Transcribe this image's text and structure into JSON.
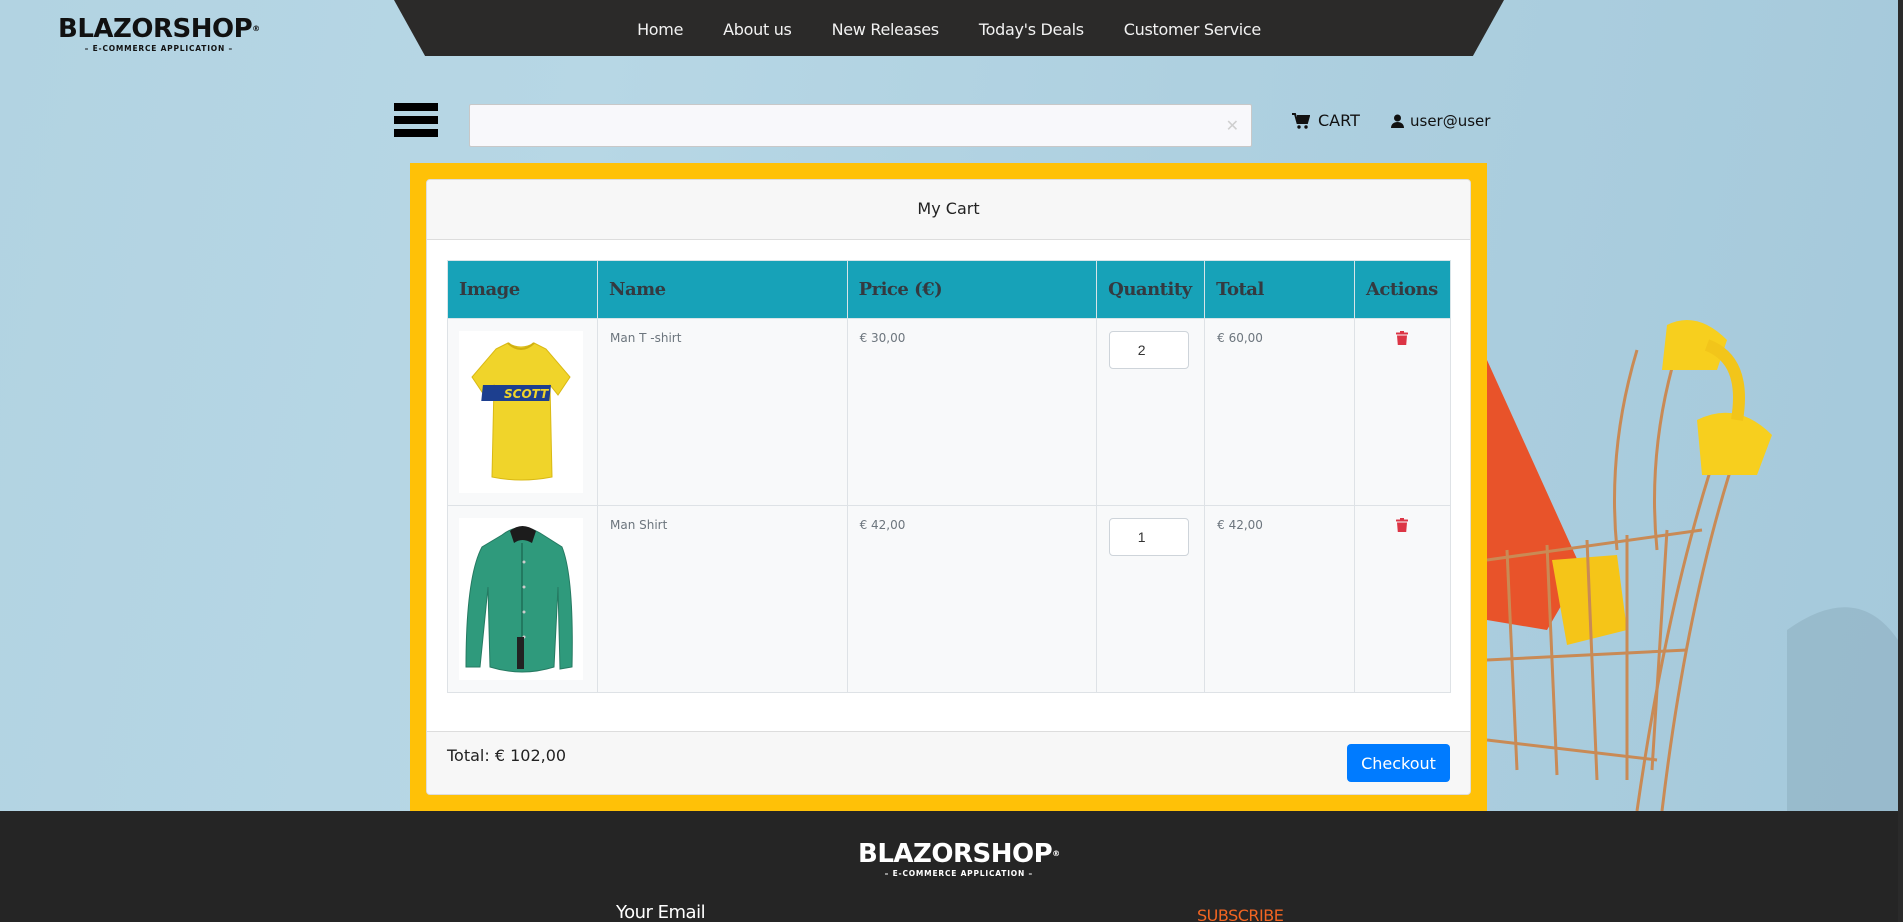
{
  "logo": {
    "brand": "BLAZORSHOP",
    "tagline": "– E-COMMERCE APPLICATION –"
  },
  "nav": [
    {
      "label": "Home"
    },
    {
      "label": "About us"
    },
    {
      "label": "New Releases"
    },
    {
      "label": "Today's Deals"
    },
    {
      "label": "Customer Service"
    }
  ],
  "toolbar": {
    "menu_icon": "hamburger-icon",
    "search": {
      "value": "",
      "placeholder": "",
      "clear_label": "✕"
    },
    "cart_label": "CART",
    "cart_icon": "shopping-cart-icon",
    "user_label": "user@user",
    "user_icon": "user-icon"
  },
  "cart": {
    "title": "My Cart",
    "columns": [
      "Image",
      "Name",
      "Price (€)",
      "Quantity",
      "Total",
      "Actions"
    ],
    "items": [
      {
        "image": "yellow-tshirt",
        "name": "Man T -shirt",
        "price": "€ 30,00",
        "quantity": "2",
        "total": "€ 60,00",
        "action_icon": "trash-icon"
      },
      {
        "image": "green-shirt",
        "name": "Man Shirt",
        "price": "€ 42,00",
        "quantity": "1",
        "total": "€ 42,00",
        "action_icon": "trash-icon"
      }
    ],
    "total_label": "Total: € 102,00",
    "checkout_label": "Checkout"
  },
  "colors": {
    "accent_yellow": "#ffc107",
    "table_header": "#17a2b8",
    "checkout_blue": "#007bff",
    "trash_red": "#dc3545",
    "nav_dark": "#2b2a29",
    "subscribe_orange": "#f26522"
  },
  "footer": {
    "brand": "BLAZORSHOP",
    "tagline": "– E-COMMERCE APPLICATION –",
    "email_label": "Your Email",
    "subscribe_label": "SUBSCRIBE"
  }
}
